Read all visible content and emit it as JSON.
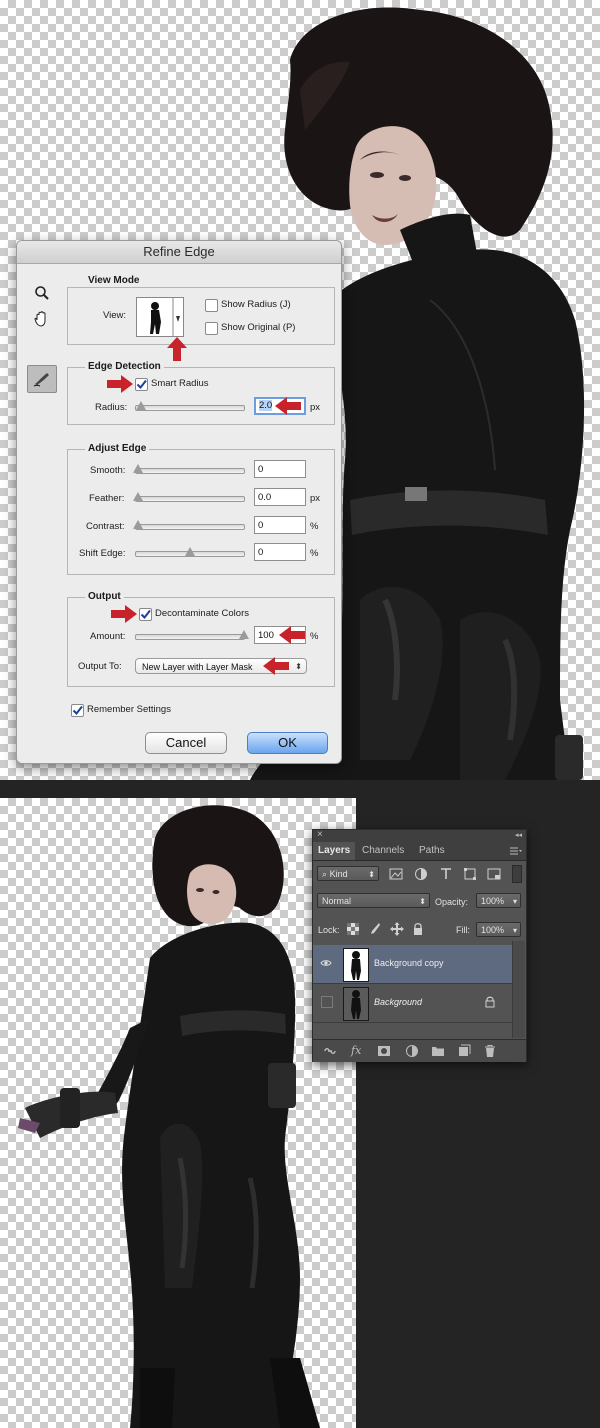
{
  "refine_edge": {
    "title": "Refine Edge",
    "view_mode": {
      "group_label": "View Mode",
      "view_label": "View:",
      "show_radius": {
        "label": "Show Radius (J)",
        "checked": false
      },
      "show_original": {
        "label": "Show Original (P)",
        "checked": false
      }
    },
    "edge_detection": {
      "group_label": "Edge Detection",
      "smart_radius": {
        "label": "Smart Radius",
        "checked": true
      },
      "radius_label": "Radius:",
      "radius_value": "2.0",
      "radius_unit": "px",
      "radius_slider_fraction": 0.05
    },
    "adjust_edge": {
      "group_label": "Adjust Edge",
      "smooth_label": "Smooth:",
      "smooth_value": "0",
      "feather_label": "Feather:",
      "feather_value": "0.0",
      "feather_unit": "px",
      "contrast_label": "Contrast:",
      "contrast_value": "0",
      "contrast_unit": "%",
      "shift_edge_label": "Shift Edge:",
      "shift_edge_value": "0",
      "shift_edge_unit": "%",
      "shift_edge_slider_fraction": 0.5
    },
    "output": {
      "group_label": "Output",
      "decontaminate": {
        "label": "Decontaminate Colors",
        "checked": true
      },
      "amount_label": "Amount:",
      "amount_value": "100",
      "amount_unit": "%",
      "amount_slider_fraction": 1.0,
      "output_to_label": "Output To:",
      "output_to_value": "New Layer with Layer Mask"
    },
    "remember_settings": {
      "label": "Remember Settings",
      "checked": true
    },
    "cancel_label": "Cancel",
    "ok_label": "OK",
    "tools": [
      "zoom-icon",
      "hand-icon",
      "refine-radius-brush-icon"
    ]
  },
  "layers_panel": {
    "close_glyph": "×",
    "collapse_glyph": "◂◂",
    "tabs": [
      {
        "label": "Layers",
        "active": true
      },
      {
        "label": "Channels",
        "active": false
      },
      {
        "label": "Paths",
        "active": false
      }
    ],
    "filter_label": "Kind",
    "blend_mode": "Normal",
    "opacity_label": "Opacity:",
    "opacity_value": "100%",
    "lock_label": "Lock:",
    "fill_label": "Fill:",
    "fill_value": "100%",
    "layers": [
      {
        "name": "Background copy",
        "visible": true,
        "selected": true,
        "locked": false
      },
      {
        "name": "Background",
        "visible": false,
        "selected": false,
        "locked": true
      }
    ]
  },
  "colors": {
    "arrow_red": "#c8222a",
    "panel_bg": "#535353",
    "selected_layer": "#5e6a80",
    "ok_button": "#6aa5ee"
  }
}
